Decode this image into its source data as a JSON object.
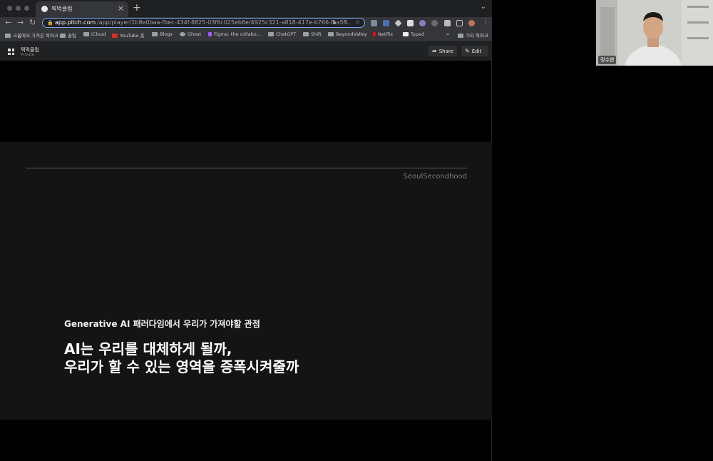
{
  "browser": {
    "tab_title": "찍먹클럽",
    "tab_close": "×",
    "new_tab": "+",
    "tab_menu": "⌄",
    "url_host": "app.pitch.com",
    "url_path": "/app/player/1b8e0baa-fbec-434f-8825-03f6c025eb6e/4925c321-a818-417e-b766-faa5f...",
    "nav": {
      "back": "←",
      "forward": "→",
      "reload": "↻"
    },
    "bookmarks": [
      "크롬에서 가져온 북마크",
      "꿀팁",
      "iCloud",
      "YouTube 홈",
      "Blogs",
      "Ghost",
      "Figma: the collabo...",
      "ChatGPT",
      "Shift",
      "BeyondValley",
      "Netflix",
      "Typed",
      "»",
      "기타 북마크"
    ]
  },
  "app": {
    "deck_title": "찍먹클럽",
    "deck_subtitle": "Private",
    "share_label": "Share",
    "edit_label": "Edit"
  },
  "slide": {
    "brand": "SeoulSecondhood",
    "kicker": "Generative AI 패러다임에서 우리가 가져야할 관점",
    "headline_line1": "AI는 우리를 대체하게 될까,",
    "headline_line2": "우리가 할 수 있는 영역을 증폭시켜줄까"
  },
  "webcam": {
    "participant_name": "정수현"
  },
  "colors": {
    "omnibox_focus": "#7aa7f5",
    "slide_bg": "#141414",
    "chrome_toolbar": "#35363a"
  }
}
